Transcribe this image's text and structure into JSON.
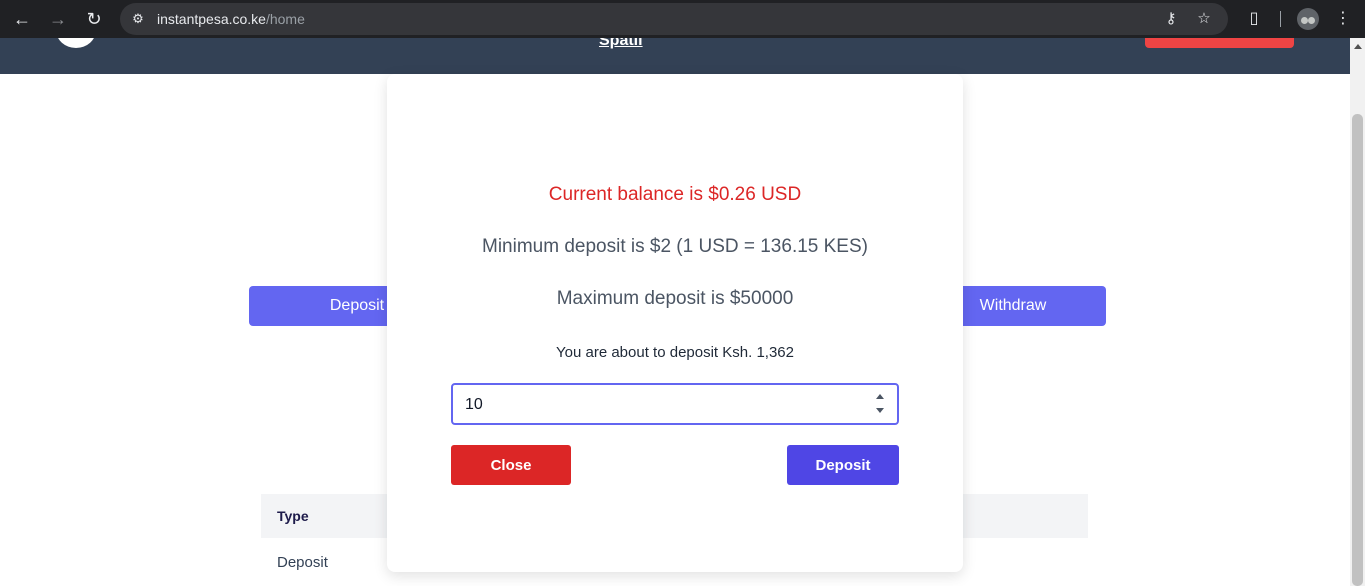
{
  "browser": {
    "url_host": "instantpesa.co.ke",
    "url_path": "/home",
    "icons": {
      "back": "arrow-left-icon",
      "forward": "arrow-right-icon",
      "reload": "reload-icon",
      "site_info": "tune-icon",
      "password": "key-icon",
      "bookmark": "star-icon",
      "extensions": "puzzle-icon",
      "menu": "more-vert-icon"
    }
  },
  "header": {
    "link_label": "Spatil"
  },
  "background": {
    "deposit_label": "Deposit",
    "withdraw_label": "Withdraw",
    "table_header_type": "Type",
    "row_type": "Deposit"
  },
  "modal": {
    "balance_text": "Current balance is $0.26 USD",
    "min_text": "Minimum deposit is $2 (1 USD = 136.15 KES)",
    "max_text": "Maximum deposit is $50000",
    "about_text": "You are about to deposit Ksh. 1,362",
    "amount_value": "10",
    "close_label": "Close",
    "deposit_label": "Deposit"
  },
  "colors": {
    "balance_red": "#dc2626",
    "primary_indigo": "#4f46e5",
    "header_slate": "#334155"
  }
}
